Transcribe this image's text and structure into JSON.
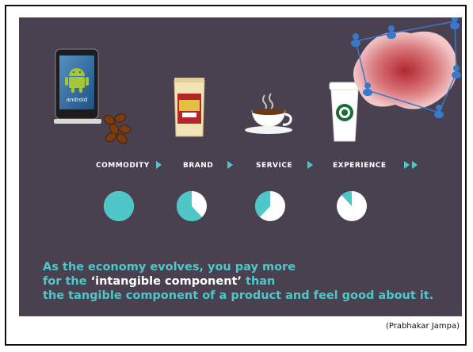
{
  "stages": [
    {
      "label": "COMMODITY",
      "pie_fraction": 1.0
    },
    {
      "label": "BRAND",
      "pie_fraction": 0.62
    },
    {
      "label": "SERVICE",
      "pie_fraction": 0.38
    },
    {
      "label": "EXPERIENCE",
      "pie_fraction": 0.12
    }
  ],
  "phone_text": "android",
  "caption": {
    "line1": "As the economy evolves, you pay more",
    "line2_pre": "for the ",
    "line2_hl": "‘intangible component’",
    "line2_post": " than",
    "line3": "the tangible component of a product and feel good about it."
  },
  "credit": "(Prabhakar Jampa)",
  "colors": {
    "panel": "#4a4150",
    "accent": "#4fc7c9",
    "pie_bg": "#ffffff"
  }
}
